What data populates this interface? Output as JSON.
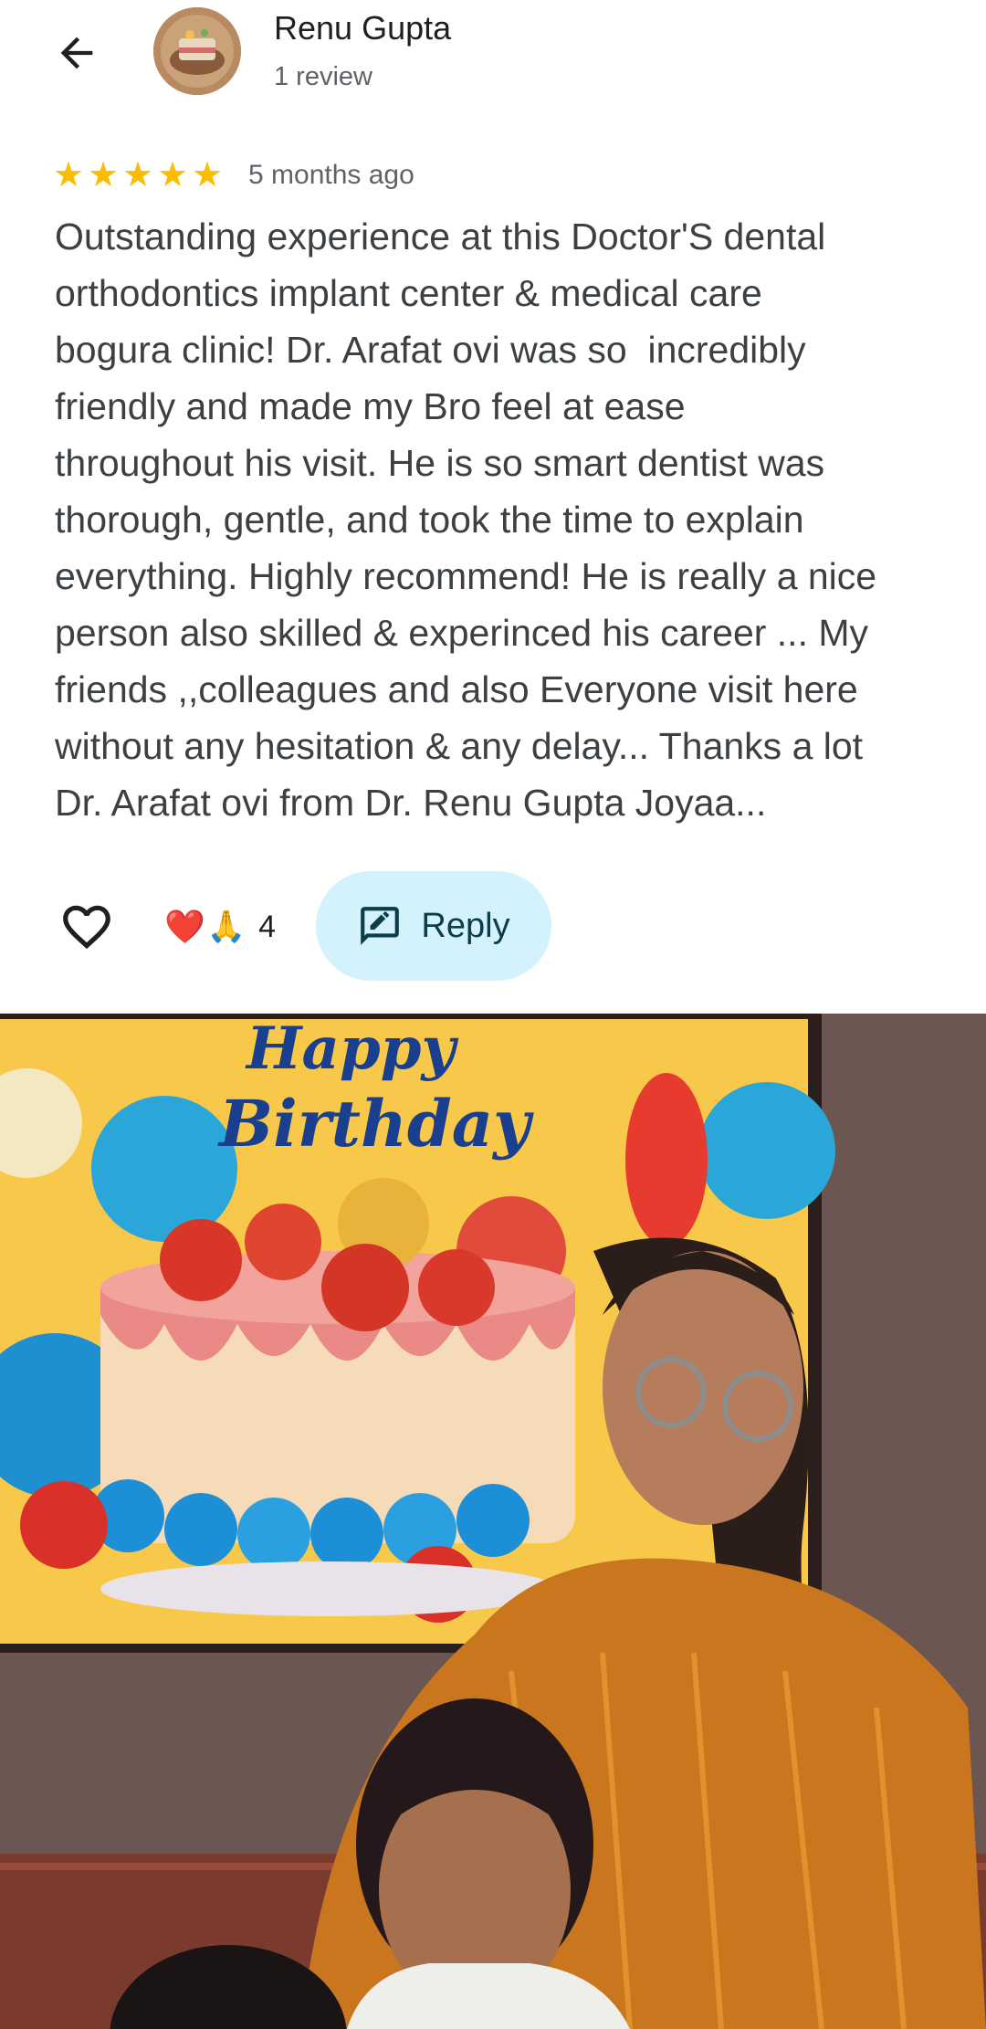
{
  "header": {
    "back_icon": "arrow-left-icon",
    "reviewer_name": "Renu Gupta",
    "reviewer_meta": "1 review"
  },
  "review": {
    "rating": 5,
    "max_rating": 5,
    "star_color": "#fbbc04",
    "date": "5 months ago",
    "text": "Outstanding experience at this Doctor'S dental\northodontics implant center & medical care\nbogura clinic! Dr. Arafat ovi was so  incredibly\nfriendly and made my Bro feel at ease\nthroughout his visit. He is so smart dentist was\nthorough, gentle, and took the time to explain\neverything. Highly recommend! He is really a nice\nperson also skilled & experinced his career ... My\nfriends ,,colleagues and also Everyone visit here\nwithout any hesitation & any delay... Thanks a lot\nDr. Arafat ovi from Dr. Renu Gupta Joyaa..."
  },
  "actions": {
    "like_icon": "heart-outline-icon",
    "reaction_emojis": [
      "❤️",
      "🙏"
    ],
    "reaction_count": "4",
    "reply_icon": "reply-edit-icon",
    "reply_label": "Reply",
    "reply_bg": "#d3f2fb"
  },
  "photo": {
    "banner_line1": "Happy",
    "banner_line2": "Birthday"
  }
}
